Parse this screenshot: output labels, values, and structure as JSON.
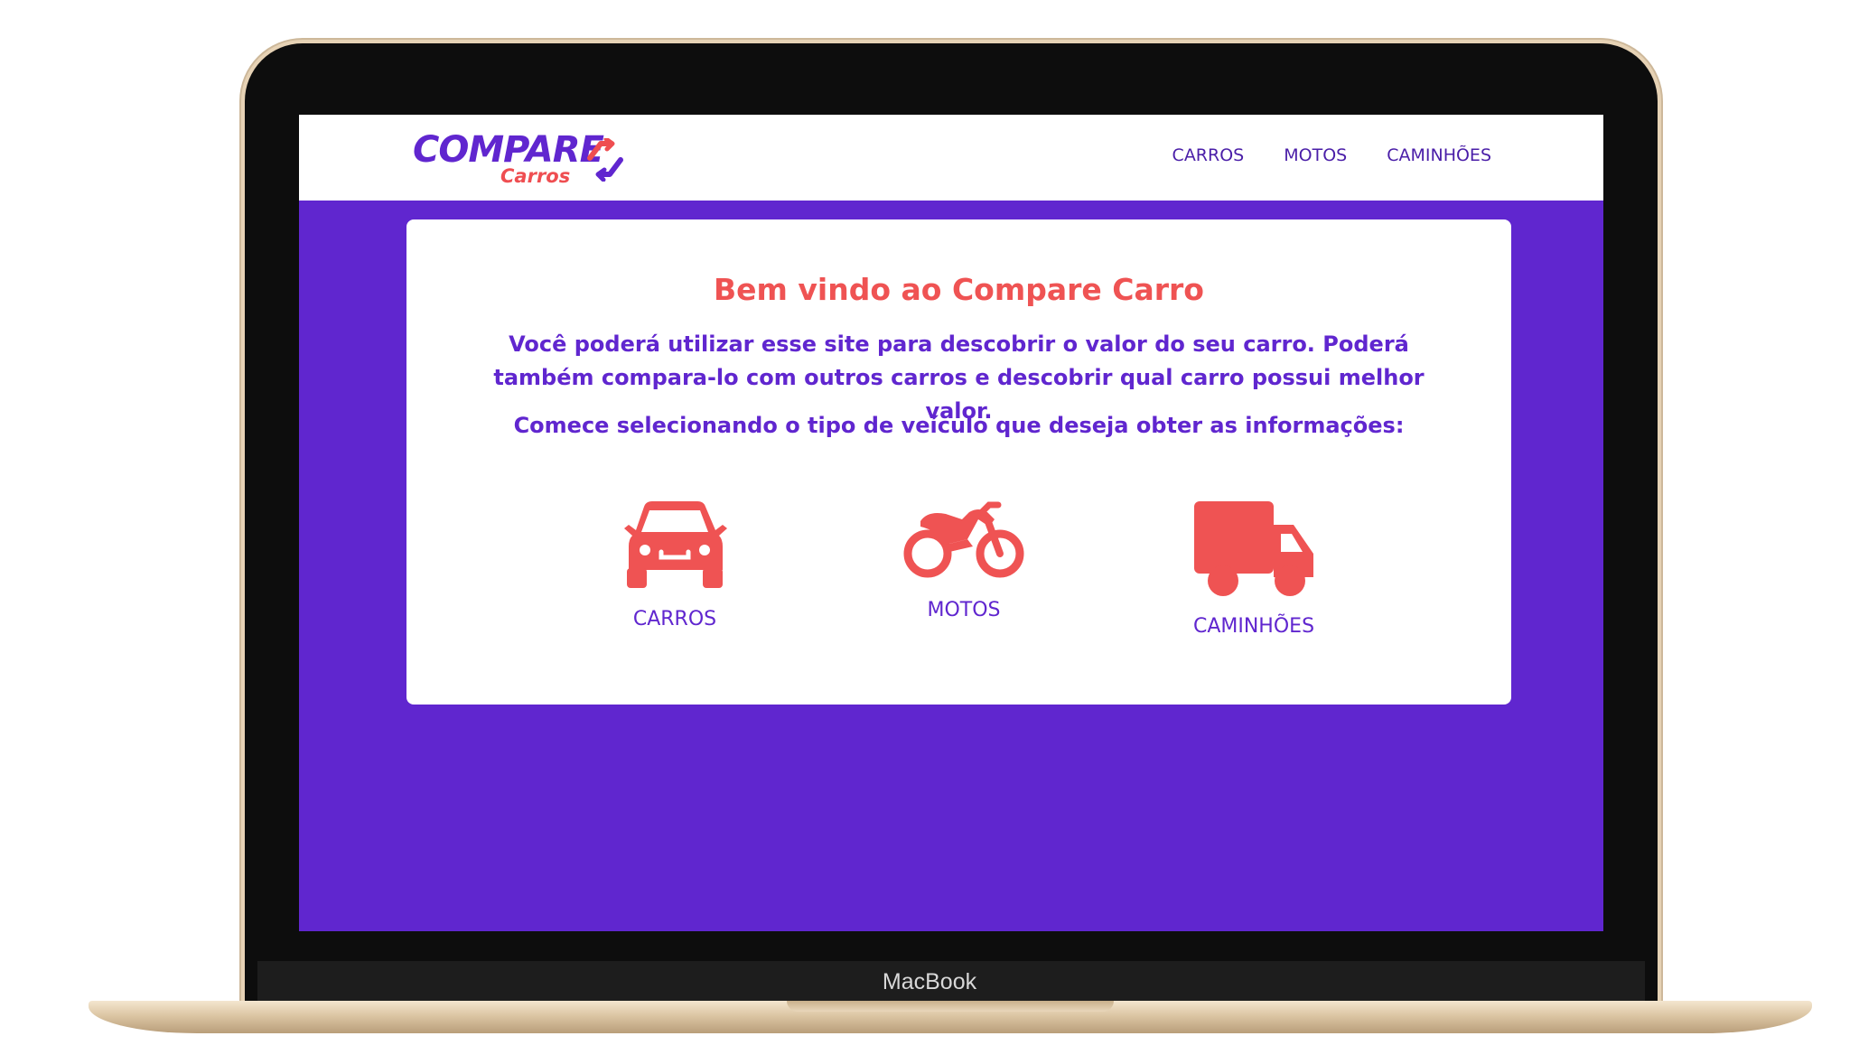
{
  "device": {
    "label": "MacBook"
  },
  "header": {
    "logo": {
      "main": "COMPARE",
      "sub": "Carros"
    },
    "nav": [
      {
        "label": "CARROS"
      },
      {
        "label": "MOTOS"
      },
      {
        "label": "CAMINHÕES"
      }
    ]
  },
  "main": {
    "title": "Bem vindo ao Compare Carro",
    "text": "Você poderá utilizar esse site para descobrir o valor do seu carro. Poderá também compara-lo com outros carros e descobrir qual carro possui melhor valor.",
    "cta": "Comece selecionando o tipo de veículo que deseja obter as informações:",
    "vehicles": [
      {
        "label": "CARROS",
        "icon": "car-icon"
      },
      {
        "label": "MOTOS",
        "icon": "motorcycle-icon"
      },
      {
        "label": "CAMINHÕES",
        "icon": "truck-icon"
      }
    ]
  },
  "colors": {
    "primary": "#6026cf",
    "accent": "#ef5353",
    "card": "#ffffff"
  }
}
